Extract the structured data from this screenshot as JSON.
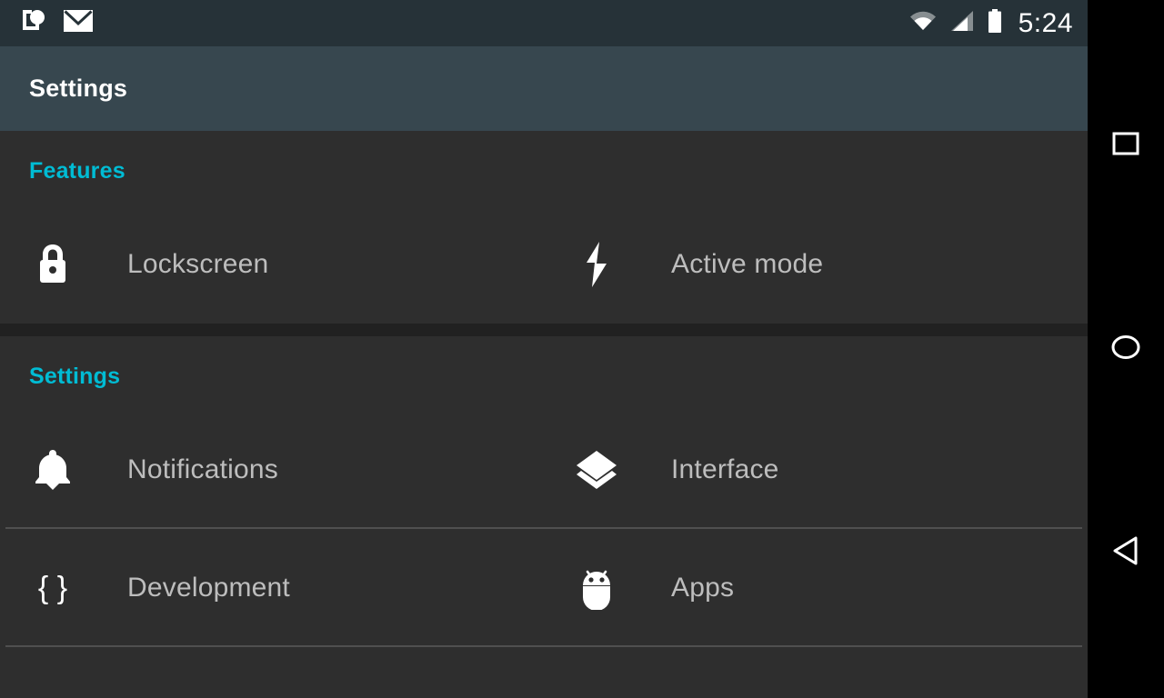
{
  "status_bar": {
    "time": "5:24",
    "left_icons": [
      {
        "name": "sms-message-icon"
      },
      {
        "name": "email-envelope-icon"
      }
    ],
    "right_icons": [
      {
        "name": "wifi-icon"
      },
      {
        "name": "cellular-signal-icon"
      },
      {
        "name": "battery-icon"
      }
    ],
    "background_color": "#263238"
  },
  "action_bar": {
    "title": "Settings",
    "background_color": "#37474f",
    "title_color": "#ffffff"
  },
  "theme": {
    "accent_color": "#00bcd4",
    "content_background": "#2e2e2e",
    "label_color": "#bdbdbd",
    "divider_color": "#4f4f4f",
    "section_gap_color": "#212121"
  },
  "sections": [
    {
      "header": "Features",
      "rows": [
        {
          "items": [
            {
              "label": "Lockscreen",
              "icon": "lock-icon"
            },
            {
              "label": "Active mode",
              "icon": "lightning-bolt-icon"
            }
          ],
          "divider": false
        }
      ]
    },
    {
      "header": "Settings",
      "rows": [
        {
          "items": [
            {
              "label": "Notifications",
              "icon": "bell-icon"
            },
            {
              "label": "Interface",
              "icon": "layers-icon"
            }
          ],
          "divider": true
        },
        {
          "items": [
            {
              "label": "Development",
              "icon": "curly-braces-icon"
            },
            {
              "label": "Apps",
              "icon": "android-robot-icon"
            }
          ],
          "divider": true
        }
      ]
    }
  ],
  "nav_bar": {
    "background_color": "#000000",
    "buttons": [
      {
        "name": "recents-button",
        "icon": "square-icon"
      },
      {
        "name": "home-button",
        "icon": "circle-icon"
      },
      {
        "name": "back-button",
        "icon": "triangle-back-icon"
      }
    ]
  }
}
